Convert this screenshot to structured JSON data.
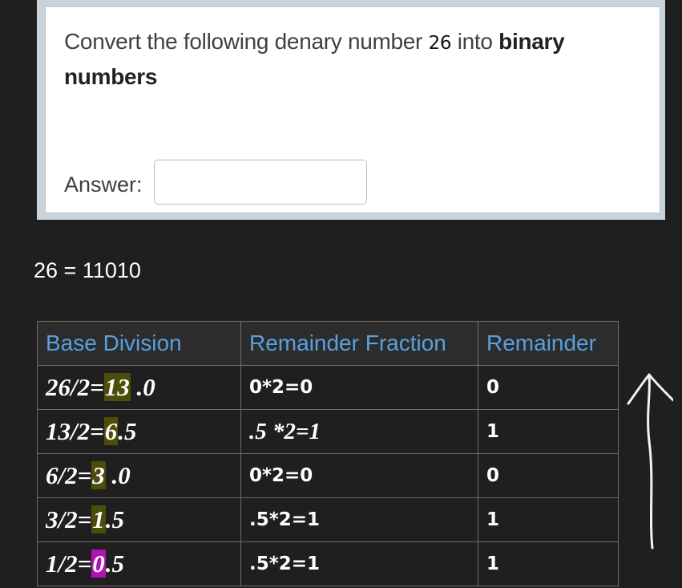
{
  "question": {
    "prefix": "Convert the following denary number ",
    "number": "26",
    "middle": " into ",
    "bold": "binary numbers",
    "answer_label": "Answer:",
    "answer_value": ""
  },
  "result": "26 = 11010",
  "table": {
    "headers": [
      "Base Division",
      "Remainder Fraction",
      "Remainder"
    ],
    "rows": [
      {
        "pre": "26/2=",
        "quot": "13",
        "post": " .0",
        "frac": "0*2=0",
        "rem": "0"
      },
      {
        "pre": "13/2=",
        "quot": "6",
        "post": ".5",
        "frac": ".5 *2=1",
        "rem": "1"
      },
      {
        "pre": "6/2=",
        "quot": "3",
        "post": " .0",
        "frac": "0*2=0",
        "rem": "0"
      },
      {
        "pre": "3/2=",
        "quot": "1",
        "post": ".5",
        "frac": ".5*2=1",
        "rem": "1"
      },
      {
        "pre": "1/2=",
        "quot": "0",
        "post": ".5",
        "frac": ".5*2=1",
        "rem": "1"
      }
    ]
  },
  "colors": {
    "header_text": "#5aa0e0",
    "highlight": "#4d4d0b",
    "highlight_last": "#b014b0",
    "background": "#1f1f1f"
  },
  "icons": {
    "annotation": "hand-drawn-up-arrow-icon"
  }
}
